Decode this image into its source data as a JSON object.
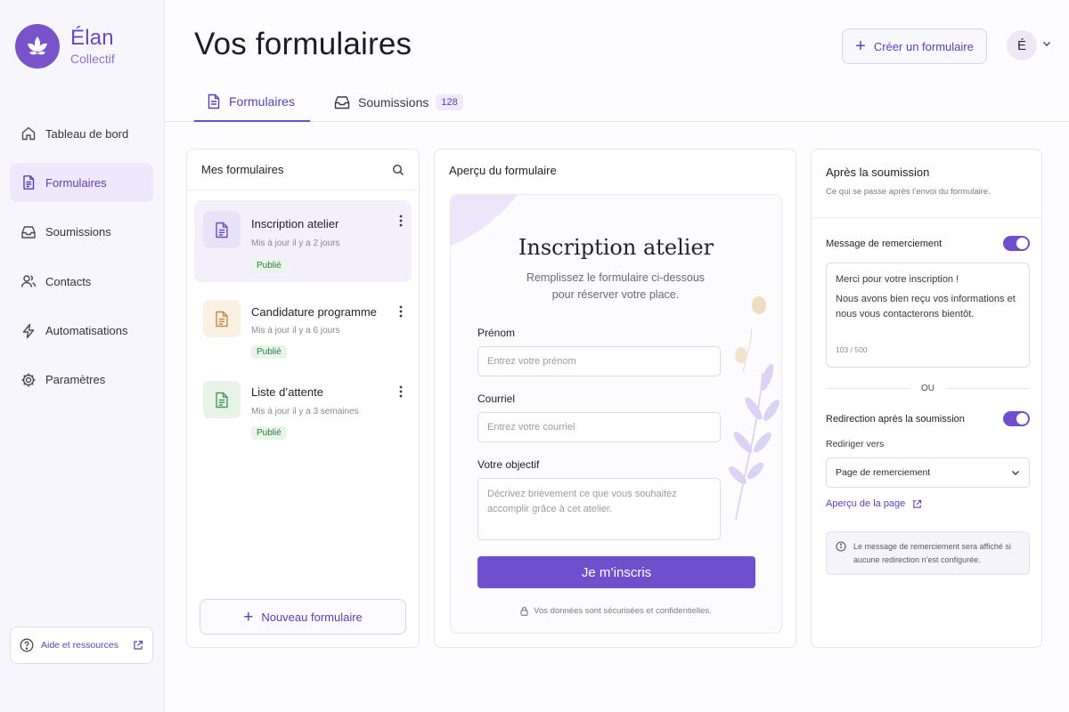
{
  "brand": {
    "name": "Élan",
    "subtitle": "Collectif"
  },
  "sidebar": {
    "items": [
      {
        "label": "Tableau de bord",
        "icon": "home-icon"
      },
      {
        "label": "Formulaires",
        "icon": "document-icon",
        "active": true
      },
      {
        "label": "Soumissions",
        "icon": "inbox-icon"
      },
      {
        "label": "Contacts",
        "icon": "users-icon"
      },
      {
        "label": "Automatisations",
        "icon": "bolt-icon"
      },
      {
        "label": "Paramètres",
        "icon": "gear-icon"
      }
    ],
    "help_label": "Aide et ressources"
  },
  "header": {
    "title": "Vos formulaires",
    "create_button": "Créer un formulaire",
    "avatar_initial": "É"
  },
  "tabs": [
    {
      "label": "Formulaires",
      "active": true
    },
    {
      "label": "Soumissions",
      "count": "128"
    }
  ],
  "forms_panel": {
    "title": "Mes formulaires",
    "forms": [
      {
        "title": "Inscription atelier",
        "meta": "Mis à jour il y a 2 jours",
        "status": "Publié",
        "selected": true,
        "color": "#7a5ad0"
      },
      {
        "title": "Candidature programme",
        "meta": "Mis à jour il y a 6 jours",
        "status": "Publié",
        "color": "#c79a55"
      },
      {
        "title": "Liste d’attente",
        "meta": "Mis à jour il y a 3 semaines",
        "status": "Publié",
        "color": "#4e9a5e"
      }
    ],
    "new_button": "Nouveau formulaire"
  },
  "preview": {
    "panel_title": "Aperçu du formulaire",
    "form_title": "Inscription atelier",
    "subtitle_line1": "Remplissez le formulaire ci-dessous",
    "subtitle_line2": "pour réserver votre place.",
    "fields": {
      "first_name": {
        "label": "Prénom",
        "placeholder": "Entrez votre prénom"
      },
      "email": {
        "label": "Courriel",
        "placeholder": "Entrez votre courriel"
      },
      "goal": {
        "label": "Votre objectif",
        "placeholder": "Décrivez brièvement ce que vous souhaitez accomplir grâce à cet atelier."
      }
    },
    "submit_label": "Je m’inscris",
    "secure_note": "Vos données sont sécurisées et confidentielles."
  },
  "after": {
    "title": "Après la soumission",
    "description": "Ce qui se passe après l’envoi du formulaire.",
    "thanks_toggle_label": "Message de remerciement",
    "thanks_toggle_on": true,
    "message_line1": "Merci pour votre inscription !",
    "message_line2": "Nous avons bien reçu vos informations et nous vous contacterons bientôt.",
    "char_count": "103 / 500",
    "or_label": "OU",
    "redirect_toggle_label": "Redirection après la soumission",
    "redirect_toggle_on": true,
    "redirect_to_label": "Rediriger vers",
    "redirect_value": "Page de remerciement",
    "preview_link": "Aperçu de la page",
    "info_note": "Le message de remerciement sera affiché si aucune redirection n’est configurée."
  },
  "colors": {
    "accent": "#6f4fcc",
    "brand": "#7a52c9",
    "published": "#2f7a3b"
  }
}
